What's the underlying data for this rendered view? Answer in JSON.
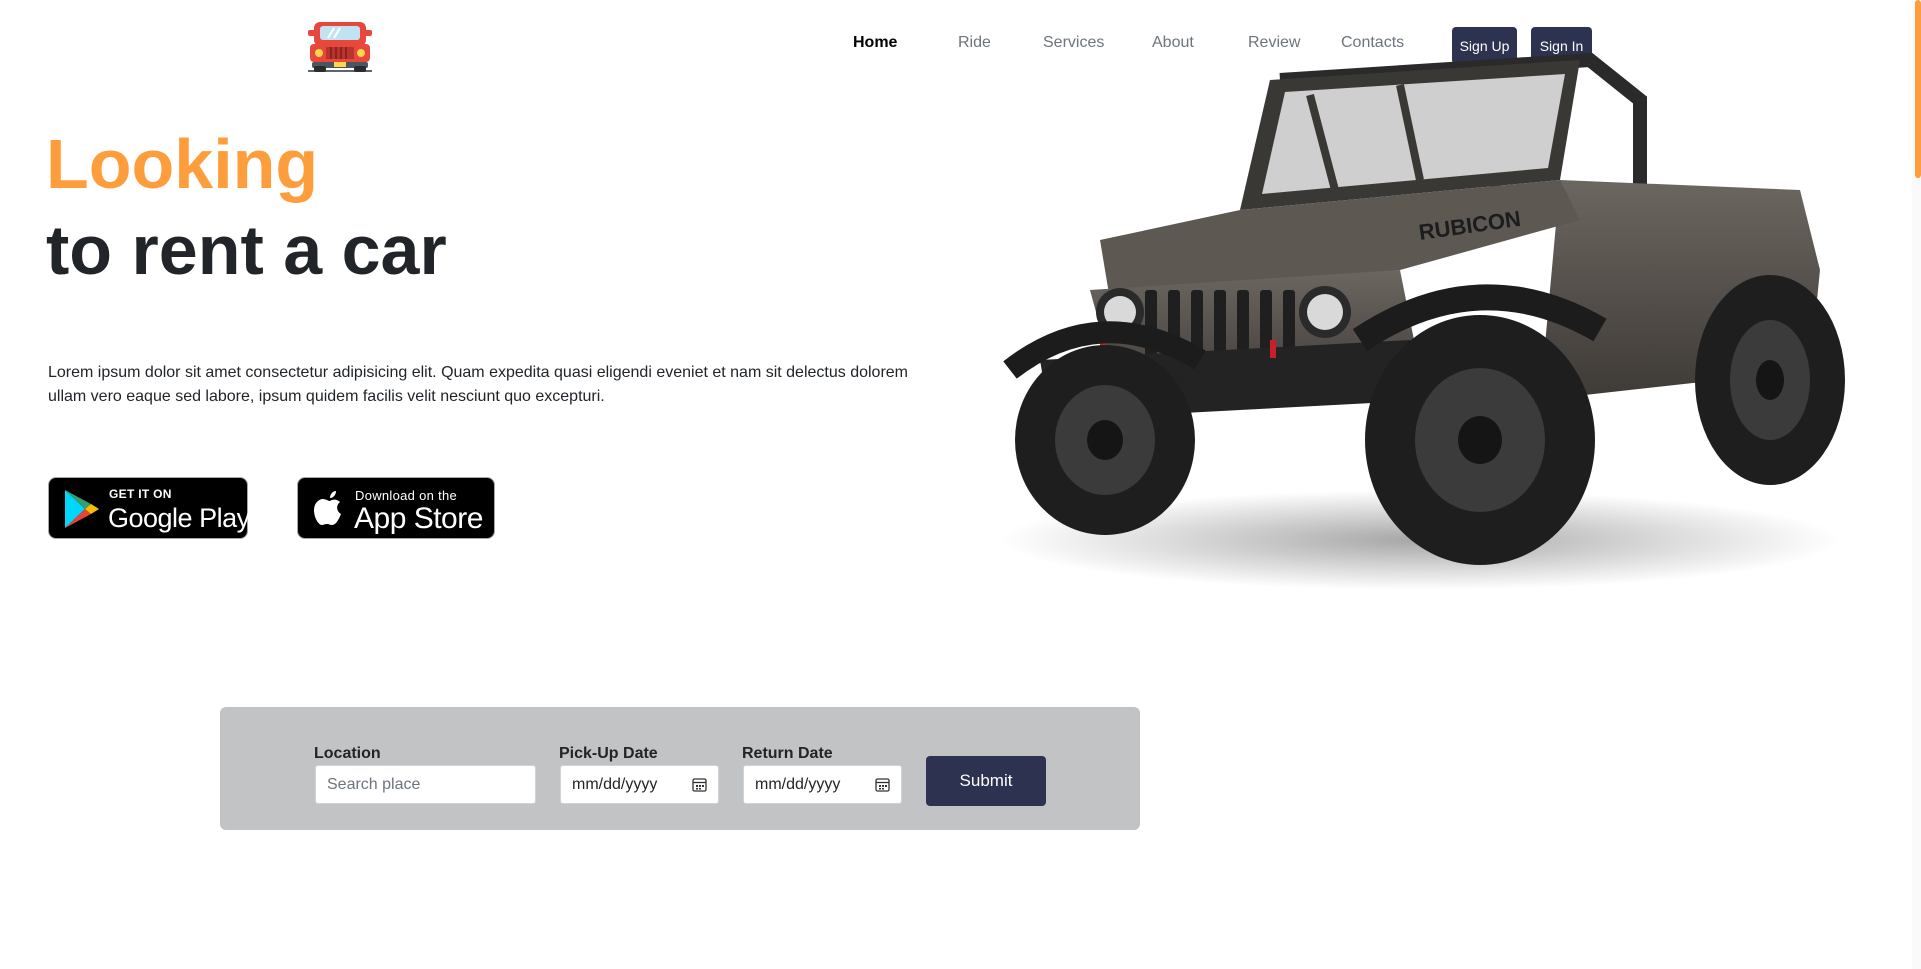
{
  "header": {
    "logo_icon": "jeep-logo-icon",
    "nav": [
      {
        "label": "Home",
        "active": true
      },
      {
        "label": "Ride",
        "active": false
      },
      {
        "label": "Services",
        "active": false
      },
      {
        "label": "About",
        "active": false
      },
      {
        "label": "Review",
        "active": false
      },
      {
        "label": "Contacts",
        "active": false
      }
    ],
    "signup_label": "Sign Up",
    "signin_label": "Sign In"
  },
  "hero": {
    "accent": "Looking",
    "title": "to rent a car",
    "description": "Lorem ipsum dolor sit amet consectetur adipisicing elit. Quam expedita quasi eligendi eveniet et nam sit delectus dolorem ullam vero eaque sed labore, ipsum quidem facilis velit nesciunt quo excepturi.",
    "car_image": "jeep-rubicon-image",
    "car_badge_text": "RUBICON"
  },
  "badges": {
    "google": {
      "small": "GET IT ON",
      "big": "Google Play",
      "icon": "google-play-icon"
    },
    "apple": {
      "small": "Download on the",
      "big": "App Store",
      "icon": "apple-icon"
    }
  },
  "booking": {
    "location_label": "Location",
    "location_placeholder": "Search place",
    "pickup_label": "Pick-Up Date",
    "pickup_value": "mm/dd/yyyy",
    "return_label": "Return Date",
    "return_value": "mm/dd/yyyy",
    "calendar_icon": "calendar-icon",
    "submit_label": "Submit"
  },
  "colors": {
    "accent": "#fd9d3c",
    "primary_dark": "#2d3250",
    "form_bg": "#c1c3c4"
  }
}
